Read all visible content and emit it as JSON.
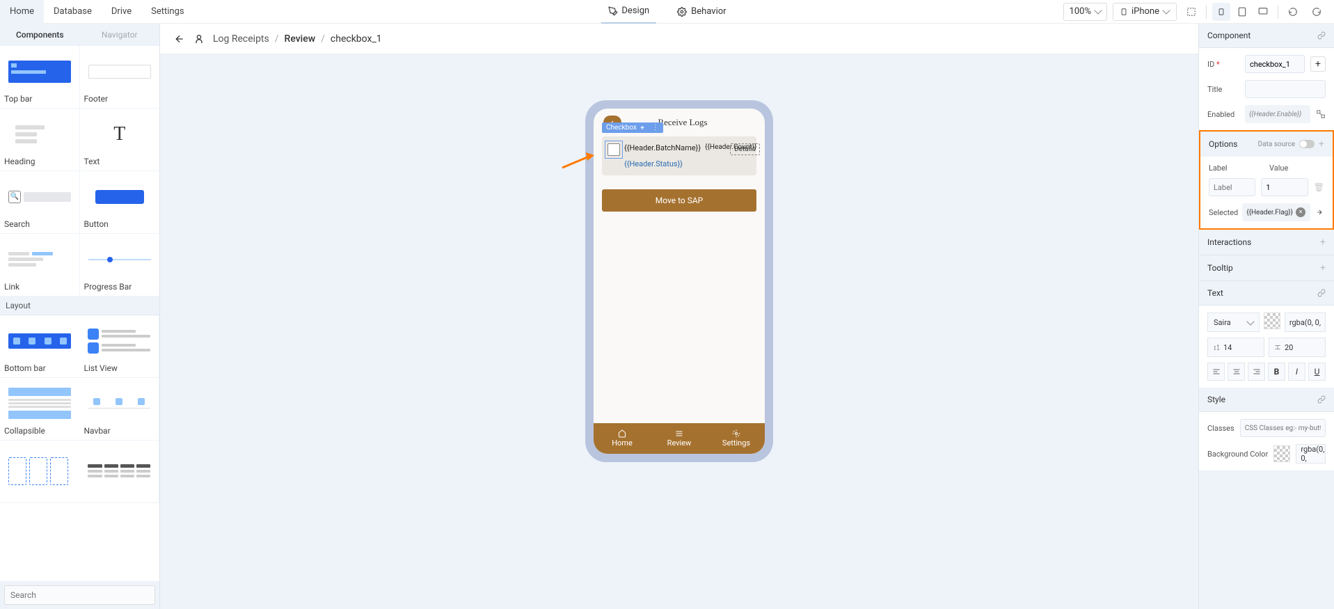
{
  "topbar": {
    "menu": [
      "Home",
      "Database",
      "Drive",
      "Settings"
    ],
    "center": {
      "design": "Design",
      "behavior": "Behavior"
    },
    "zoom": "100%",
    "device": "iPhone"
  },
  "left": {
    "tabs": {
      "components": "Components",
      "navigator": "Navigator"
    },
    "items": [
      {
        "label": "Top bar"
      },
      {
        "label": "Footer"
      },
      {
        "label": "Heading"
      },
      {
        "label": "Text"
      },
      {
        "label": "Search"
      },
      {
        "label": "Button"
      },
      {
        "label": "Link"
      },
      {
        "label": "Progress Bar"
      }
    ],
    "layoutHeader": "Layout",
    "layoutItems": [
      {
        "label": "Bottom bar"
      },
      {
        "label": "List View"
      },
      {
        "label": "Collapsible"
      },
      {
        "label": "Navbar"
      },
      {
        "label": ""
      },
      {
        "label": ""
      }
    ],
    "searchPlaceholder": "Search"
  },
  "breadcrumb": {
    "root": "Log Receipts",
    "mid": "Review",
    "leaf": "checkbox_1"
  },
  "phone": {
    "title": "Receive Logs",
    "card": {
      "tag": "Checkbox",
      "batchName": "{{Header.BatchName}}",
      "status": "{{Header.Status}}",
      "count": "{{Header.Count}}",
      "details": "Details"
    },
    "moveBtn": "Move to SAP",
    "bottom": [
      "Home",
      "Review",
      "Settings"
    ]
  },
  "right": {
    "component": {
      "header": "Component",
      "idLabel": "ID",
      "idValue": "checkbox_1",
      "titleLabel": "Title",
      "titleValue": "",
      "enabledLabel": "Enabled",
      "enabledValue": "{{Header.Enable}}"
    },
    "options": {
      "header": "Options",
      "dataSource": "Data source",
      "labelHdr": "Label",
      "valueHdr": "Value",
      "labelPlaceholder": "Label",
      "valueValue": "1",
      "selectedLabel": "Selected",
      "selectedValue": "{{Header.Flag}}"
    },
    "interactions": "Interactions",
    "tooltip": "Tooltip",
    "text": {
      "header": "Text",
      "font": "Saira",
      "color": "rgba(0, 0,",
      "fontSize": "14",
      "lineHeight": "20"
    },
    "style": {
      "header": "Style",
      "classesLabel": "Classes",
      "classesPlaceholder": "CSS Classes eg:- my-button",
      "bgLabel": "Background Color",
      "bgValue": "rgba(0, 0,"
    }
  }
}
